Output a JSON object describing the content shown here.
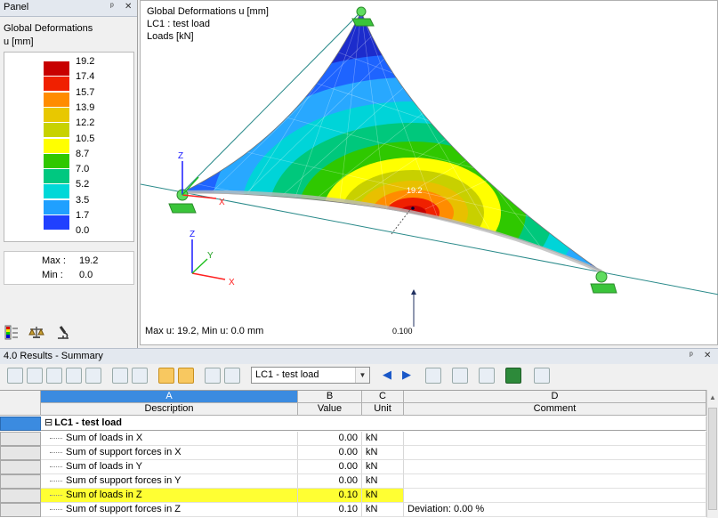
{
  "panel": {
    "title": "Panel",
    "pin": "ᵖ",
    "close": "✕",
    "legend_title": "Global Deformations",
    "legend_unit": "u [mm]",
    "legend_values": [
      "19.2",
      "17.4",
      "15.7",
      "13.9",
      "12.2",
      "10.5",
      "8.7",
      "7.0",
      "5.2",
      "3.5",
      "1.7",
      "0.0"
    ],
    "legend_colors": [
      "#c80000",
      "#f02000",
      "#ff8c00",
      "#e8c800",
      "#c8d200",
      "#ffff00",
      "#30c800",
      "#00c880",
      "#00d8d8",
      "#20a0ff",
      "#2040ff",
      "#0000b0"
    ],
    "max_label": "Max :",
    "max_value": "19.2",
    "min_label": "Min :",
    "min_value": "0.0"
  },
  "viewport": {
    "info_line1": "Global Deformations u [mm]",
    "info_line2": "LC1 : test load",
    "info_line3": "Loads [kN]",
    "footer": "Max u: 19.2, Min u: 0.0 mm",
    "scale_label": "0.100",
    "peak_label": "19.2",
    "axis_x": "X",
    "axis_y": "Y",
    "axis_z": "Z"
  },
  "results": {
    "title": "4.0 Results - Summary",
    "pin": "ᵖ",
    "close": "✕",
    "loadcase_select": "LC1 - test load",
    "columns": [
      {
        "letter": "A",
        "label": "Description"
      },
      {
        "letter": "B",
        "label": "Value"
      },
      {
        "letter": "C",
        "label": "Unit"
      },
      {
        "letter": "D",
        "label": "Comment"
      }
    ],
    "group_label": "LC1 - test load",
    "group_toggle": "⊟",
    "rows": [
      {
        "description": "Sum of loads in X",
        "value": "0.00",
        "unit": "kN",
        "comment": ""
      },
      {
        "description": "Sum of support forces in X",
        "value": "0.00",
        "unit": "kN",
        "comment": ""
      },
      {
        "description": "Sum of loads in Y",
        "value": "0.00",
        "unit": "kN",
        "comment": ""
      },
      {
        "description": "Sum of support forces in Y",
        "value": "0.00",
        "unit": "kN",
        "comment": ""
      },
      {
        "description": "Sum of loads in Z",
        "value": "0.10",
        "unit": "kN",
        "comment": ""
      },
      {
        "description": "Sum of support forces in Z",
        "value": "0.10",
        "unit": "kN",
        "comment": "Deviation:  0.00 %"
      }
    ],
    "highlight_color": "#ffff33"
  }
}
